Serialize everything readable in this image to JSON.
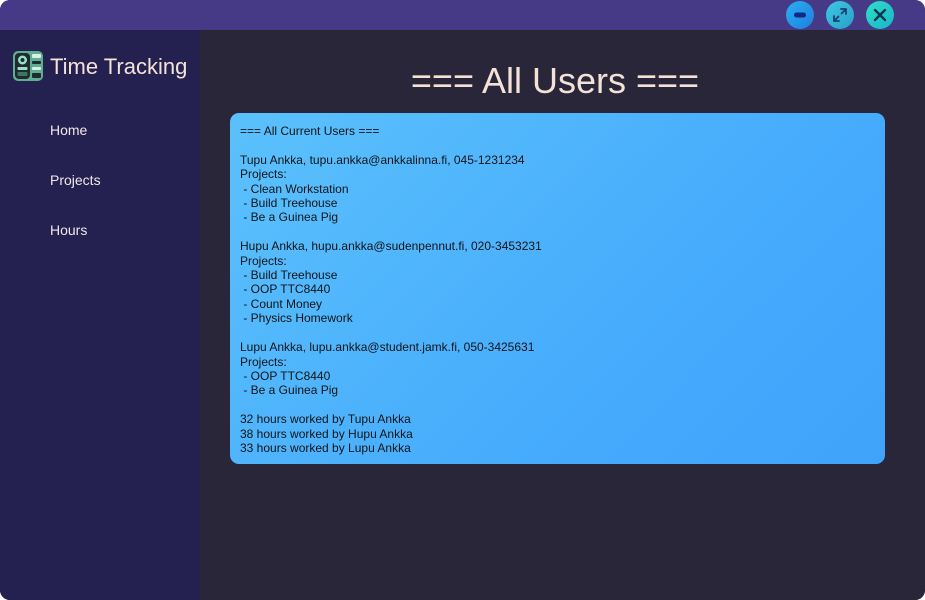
{
  "window": {
    "controls": {
      "minimize_icon": "minimize-icon",
      "maximize_icon": "maximize-icon",
      "close_icon": "close-icon"
    },
    "titlebar_color": "#463a86"
  },
  "sidebar": {
    "app_title": "Time Tracking",
    "logo_icon": "robot-logo-icon",
    "nav": [
      {
        "label": "Home"
      },
      {
        "label": "Projects"
      },
      {
        "label": "Hours"
      }
    ],
    "background": "#24204f"
  },
  "main": {
    "heading": "=== All Users ===",
    "content": "=== All Current Users ===\n\nTupu Ankka, tupu.ankka@ankkalinna.fi, 045-1231234\nProjects:\n - Clean Workstation\n - Build Treehouse\n - Be a Guinea Pig\n\nHupu Ankka, hupu.ankka@sudenpennut.fi, 020-3453231\nProjects:\n - Build Treehouse\n - OOP TTC8440\n - Count Money\n - Physics Homework\n\nLupu Ankka, lupu.ankka@student.jamk.fi, 050-3425631\nProjects:\n - OOP TTC8440\n - Be a Guinea Pig\n\n32 hours worked by Tupu Ankka\n38 hours worked by Hupu Ankka\n33 hours worked by Lupu Ankka",
    "background": "#29263a",
    "card_color": "#4eb5fc"
  }
}
